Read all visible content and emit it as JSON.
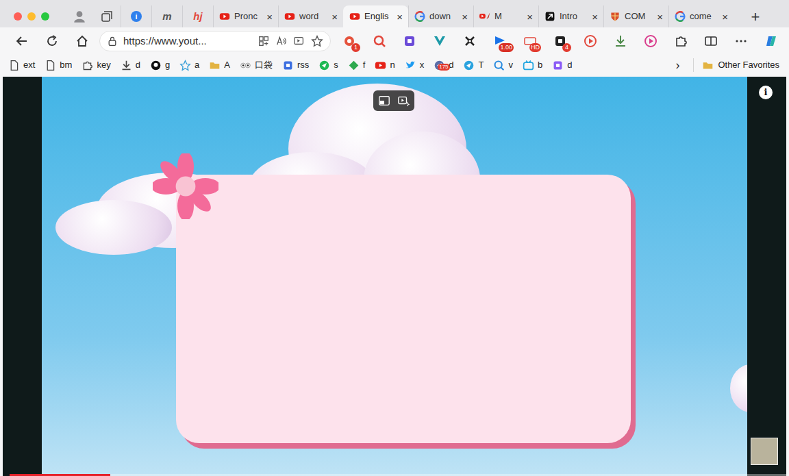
{
  "window": {
    "controls": [
      {
        "color": "#fe5f57"
      },
      {
        "color": "#febc2e"
      },
      {
        "color": "#28c840"
      }
    ]
  },
  "pinned_tabs": [
    {
      "kind": "bubble",
      "text": "i",
      "color": "#2f80ed"
    },
    {
      "kind": "logo",
      "text": "m",
      "color": "#555555"
    },
    {
      "kind": "logo",
      "text": "hj",
      "color": "#e2483d"
    }
  ],
  "tabs": [
    {
      "label": "Pronc",
      "kind": "youtube",
      "close": "×",
      "selected": false
    },
    {
      "label": "word",
      "kind": "youtube",
      "close": "×",
      "selected": false
    },
    {
      "label": "Englis",
      "kind": "youtube",
      "close": "×",
      "selected": true
    },
    {
      "label": "down",
      "kind": "google",
      "close": "×",
      "selected": false
    },
    {
      "label": "M",
      "kind": "youtube-rocket",
      "close": "×",
      "selected": false
    },
    {
      "label": "Intro",
      "kind": "arrow",
      "close": "×",
      "selected": false
    },
    {
      "label": "COM",
      "kind": "shield",
      "close": "×",
      "selected": false
    },
    {
      "label": "come",
      "kind": "google",
      "close": "×",
      "selected": false
    }
  ],
  "new_tab": "+",
  "address": {
    "text": "https://www.yout..."
  },
  "extensions": [
    {
      "kind": "dot",
      "color": "#e5533d",
      "badge": "1"
    },
    {
      "kind": "search",
      "color": "#e2483d"
    },
    {
      "kind": "square",
      "color": "#6b4bd8"
    },
    {
      "kind": "vee",
      "color": "#1d9aa8"
    },
    {
      "kind": "cross",
      "color": "#222222"
    },
    {
      "kind": "flag",
      "color": "#1a73e8",
      "badge": "1.00"
    },
    {
      "kind": "hd",
      "color": "#e2483d",
      "badge": "HD"
    },
    {
      "kind": "square",
      "color": "#222222",
      "badge": "4"
    },
    {
      "kind": "play",
      "color": "#e2483d"
    },
    {
      "kind": "download",
      "color": "#4e8a4b"
    },
    {
      "kind": "play",
      "color": "#d93c8c"
    },
    {
      "kind": "puzzle",
      "color": "#333333"
    }
  ],
  "bookmarks": [
    {
      "label": "ext",
      "kind": "page",
      "color": "#444444"
    },
    {
      "label": "bm",
      "kind": "page",
      "color": "#444444"
    },
    {
      "label": "key",
      "kind": "puzzle",
      "color": "#444444"
    },
    {
      "label": "d",
      "kind": "download",
      "color": "#444444"
    },
    {
      "label": "g",
      "kind": "github",
      "color": "#111111"
    },
    {
      "label": "a",
      "kind": "star",
      "color": "#3aa0d8"
    },
    {
      "label": "A",
      "kind": "folder",
      "color": "#e3b341"
    },
    {
      "label": "口袋",
      "kind": "eyes",
      "color": "#888888"
    },
    {
      "label": "rss",
      "kind": "square",
      "color": "#3d6fe0"
    },
    {
      "label": "s",
      "kind": "circle",
      "color": "#1db954"
    },
    {
      "label": "f",
      "kind": "diamond",
      "color": "#2eaa4f"
    },
    {
      "label": "n",
      "kind": "youtube",
      "color": "#e62117"
    },
    {
      "label": "x",
      "kind": "bird",
      "color": "#1d9bf0"
    },
    {
      "label": "d",
      "kind": "circle",
      "color": "#5b6ea8",
      "badge": "175"
    },
    {
      "label": "T",
      "kind": "circle",
      "color": "#2aa3df"
    },
    {
      "label": "v",
      "kind": "search",
      "color": "#2a8bdf"
    },
    {
      "label": "b",
      "kind": "tv",
      "color": "#22a6e0"
    },
    {
      "label": "d",
      "kind": "square",
      "color": "#8b5cf6"
    }
  ],
  "bookmarks_more": "›",
  "other_favorites": "Other Favorites",
  "video": {
    "info": "i",
    "progress": {
      "level": 0.13
    }
  }
}
